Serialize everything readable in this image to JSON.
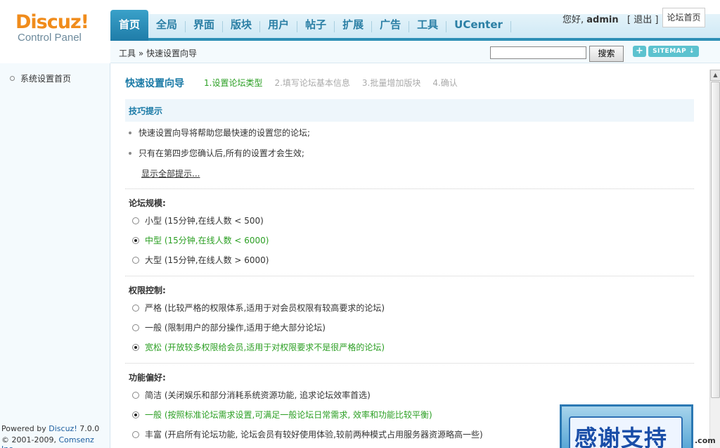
{
  "logo": {
    "main": "Discuz!",
    "sub": "Control Panel"
  },
  "nav": {
    "items": [
      "首页",
      "全局",
      "界面",
      "版块",
      "用户",
      "帖子",
      "扩展",
      "广告",
      "工具",
      "UCenter"
    ],
    "active_index": 0
  },
  "user": {
    "greeting": "您好,",
    "name": "admin",
    "logout": "[ 退出 ]",
    "forum_home": "论坛首页"
  },
  "breadcrumb": "工具 » 快速设置向导",
  "search": {
    "value": "",
    "button": "搜索"
  },
  "toolbar": {
    "plus": "+",
    "sitemap": "SITEMAP"
  },
  "sidebar": {
    "items": [
      "系统设置首页"
    ],
    "powered_by": "Powered by",
    "product": "Discuz!",
    "version": "7.0.0",
    "copyright": "© 2001-2009,",
    "company": "Comsenz Inc."
  },
  "wizard": {
    "title": "快速设置向导",
    "steps": [
      "1.设置论坛类型",
      "2.填写论坛基本信息",
      "3.批量增加版块",
      "4.确认"
    ],
    "active_step": 0
  },
  "tips": {
    "title": "技巧提示",
    "items": [
      "快速设置向导将帮助您最快速的设置您的论坛;",
      "只有在第四步您确认后,所有的设置才会生效;"
    ],
    "show_all": "显示全部提示..."
  },
  "groups": [
    {
      "title": "论坛规模:",
      "options": [
        {
          "label": "小型 (15分钟,在线人数 < 500)",
          "selected": false
        },
        {
          "label": "中型 (15分钟,在线人数 < 6000)",
          "selected": true
        },
        {
          "label": "大型 (15分钟,在线人数 > 6000)",
          "selected": false
        }
      ]
    },
    {
      "title": "权限控制:",
      "options": [
        {
          "label": "严格 (比较严格的权限体系,适用于对会员权限有较高要求的论坛)",
          "selected": false
        },
        {
          "label": "一般 (限制用户的部分操作,适用于绝大部分论坛)",
          "selected": false
        },
        {
          "label": "宽松 (开放较多权限给会员,适用于对权限要求不是很严格的论坛)",
          "selected": true
        }
      ]
    },
    {
      "title": "功能偏好:",
      "options": [
        {
          "label": "简洁 (关闭娱乐和部分消耗系统资源功能, 追求论坛效率首选)",
          "selected": false
        },
        {
          "label": "一般 (按照标准论坛需求设置,可满足一般论坛日常需求, 效率和功能比较平衡)",
          "selected": true
        },
        {
          "label": "丰富 (开启所有论坛功能, 论坛会员有较好使用体验,较前两种模式占用服务器资源略高一些)",
          "selected": false
        }
      ]
    }
  ],
  "banner": {
    "text": "感谢支持",
    "domain": ".com"
  },
  "colors": {
    "accent": "#2d8fb6",
    "selected": "#2b9f23",
    "logo": "#f08c1c"
  }
}
